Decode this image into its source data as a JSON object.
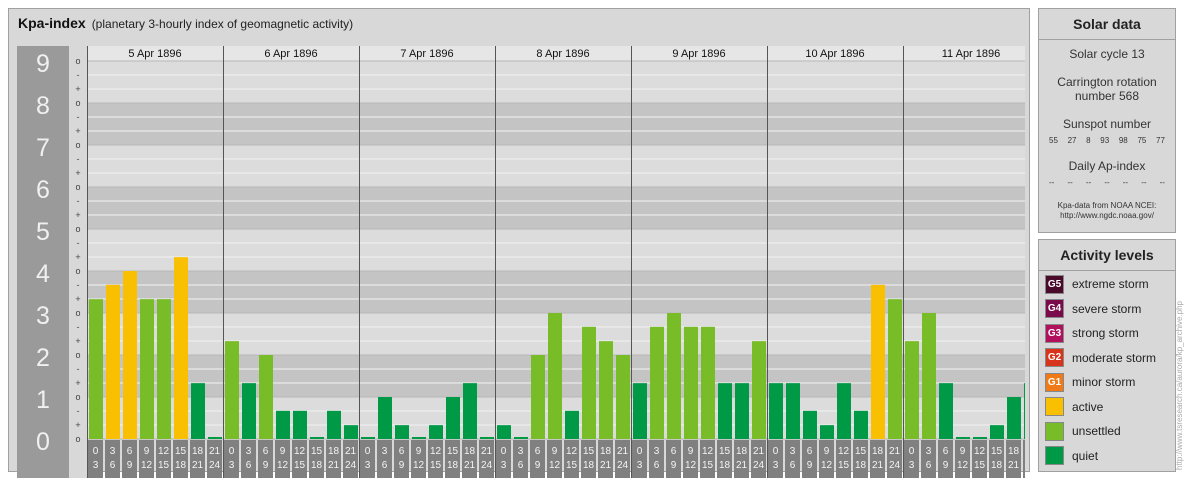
{
  "main_panel": {
    "title": "Kpa-index",
    "subtitle": "(planetary 3-hourly index of geomagnetic activity)"
  },
  "chart_data": {
    "type": "bar",
    "title": "Kpa-index",
    "subtitle": "(planetary 3-hourly index of geomagnetic activity)",
    "ylim": [
      0,
      9
    ],
    "y_ticks": [
      "0",
      "1",
      "2",
      "3",
      "4",
      "5",
      "6",
      "7",
      "8",
      "9"
    ],
    "y_fine_tick_labels": [
      "o",
      "+",
      "-"
    ],
    "days": [
      "5 Apr 1896",
      "6 Apr 1896",
      "7 Apr 1896",
      "8 Apr 1896",
      "9 Apr 1896",
      "10 Apr 1896",
      "11 Apr 1896"
    ],
    "interval_start": [
      "0",
      "3",
      "6",
      "9",
      "12",
      "15",
      "18",
      "21"
    ],
    "interval_end": [
      "3",
      "6",
      "9",
      "12",
      "15",
      "18",
      "21",
      "24"
    ],
    "series": [
      {
        "values": [
          3.33,
          3.67,
          4.0,
          3.33,
          3.33,
          4.33,
          1.33,
          0.0
        ]
      },
      {
        "values": [
          2.33,
          1.33,
          2.0,
          0.67,
          0.67,
          0.0,
          0.67,
          0.33
        ]
      },
      {
        "values": [
          0.0,
          1.0,
          0.33,
          0.0,
          0.33,
          1.0,
          1.33,
          0.0
        ]
      },
      {
        "values": [
          0.33,
          0.0,
          2.0,
          3.0,
          0.67,
          2.67,
          2.33,
          2.0
        ]
      },
      {
        "values": [
          1.33,
          2.67,
          3.0,
          2.67,
          2.67,
          1.33,
          1.33,
          2.33
        ]
      },
      {
        "values": [
          1.33,
          1.33,
          0.67,
          0.33,
          1.33,
          0.67,
          3.67,
          3.33
        ]
      },
      {
        "values": [
          2.33,
          3.0,
          1.33,
          0.0,
          0.0,
          0.33,
          1.0,
          1.33
        ]
      }
    ],
    "colors": {
      "quiet": "#009a46",
      "unsettled": "#78bc27",
      "active": "#f8c000",
      "band_dark": "#c4c4c4",
      "band_light": "#dcdcdc"
    },
    "legend_placement": "right"
  },
  "solar": {
    "title": "Solar data",
    "cycle": "Solar cycle 13",
    "carrington_line1": "Carrington rotation",
    "carrington_line2": "number 568",
    "sunspot_title": "Sunspot number",
    "sunspots": [
      "55",
      "27",
      "8",
      "93",
      "98",
      "75",
      "77"
    ],
    "ap_title": "Daily Ap-index",
    "ap_values": [
      "--",
      "--",
      "--",
      "--",
      "--",
      "--",
      "--"
    ],
    "source_line1": "Kpa-data from NOAA NCEI:",
    "source_line2": "http://www.ngdc.noaa.gov/"
  },
  "levels": {
    "title": "Activity levels",
    "items": [
      {
        "code": "G5",
        "label": "extreme storm",
        "color": "#4a0a2a"
      },
      {
        "code": "G4",
        "label": "severe storm",
        "color": "#7a0a4a"
      },
      {
        "code": "G3",
        "label": "strong storm",
        "color": "#b0105c"
      },
      {
        "code": "G2",
        "label": "moderate storm",
        "color": "#d8341c"
      },
      {
        "code": "G1",
        "label": "minor storm",
        "color": "#f07a18"
      },
      {
        "code": "",
        "label": "active",
        "color": "#f8c000"
      },
      {
        "code": "",
        "label": "unsettled",
        "color": "#78bc27"
      },
      {
        "code": "",
        "label": "quiet",
        "color": "#009a46"
      }
    ]
  },
  "watermark": "http://www.tsresearch.ca/aurora/kp_archive.php"
}
